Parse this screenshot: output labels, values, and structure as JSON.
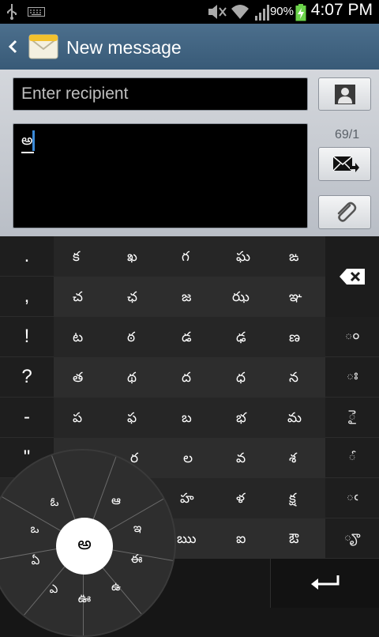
{
  "status_bar": {
    "icons": [
      "usb-icon",
      "keyboard-icon",
      "silent-mode-icon",
      "wifi-icon",
      "signal-icon",
      "battery-charging-icon"
    ],
    "battery_percent": "90%",
    "time": "4:07 PM"
  },
  "action_bar": {
    "back_icon": "chevron-left-icon",
    "app_icon": "messaging-envelope-icon",
    "title": "New message"
  },
  "compose": {
    "recipient_placeholder": "Enter recipient",
    "contact_button_icon": "contact-icon",
    "message_text": "అ",
    "char_counter": "69/1",
    "send_button_icon": "send-message-icon",
    "attach_button_icon": "paperclip-icon"
  },
  "keyboard": {
    "punctuation": [
      ".",
      ",",
      "!",
      "?",
      "-",
      "\""
    ],
    "consonant_rows": [
      [
        "క",
        "ఖ",
        "గ",
        "ఘ",
        "ఙ"
      ],
      [
        "చ",
        "ఛ",
        "జ",
        "ఝ",
        "ఞ"
      ],
      [
        "ట",
        "ఠ",
        "డ",
        "ఢ",
        "ణ"
      ],
      [
        "త",
        "థ",
        "ద",
        "ధ",
        "న"
      ],
      [
        "ప",
        "ఫ",
        "బ",
        "భ",
        "మ"
      ],
      [
        "",
        "ర",
        "ల",
        "వ",
        "శ"
      ],
      [
        "",
        "",
        "హ",
        "ళ",
        "క్ష"
      ],
      [
        "",
        "",
        "ఋ",
        "ఐ",
        "ఔ"
      ]
    ],
    "vowel_signs": [
      "ం",
      "ః",
      "ై",
      "ౕ",
      "ఁ",
      "ౄ"
    ],
    "backspace_icon": "backspace-icon",
    "enter_icon": "enter-arrow-icon",
    "radial_menu": {
      "center": "అ",
      "petals": [
        "ఆ",
        "ఇ",
        "ఈ",
        "ఉ",
        "ఊ",
        "ఎ",
        "ఏ",
        "ఒ",
        "ఓ"
      ]
    }
  }
}
